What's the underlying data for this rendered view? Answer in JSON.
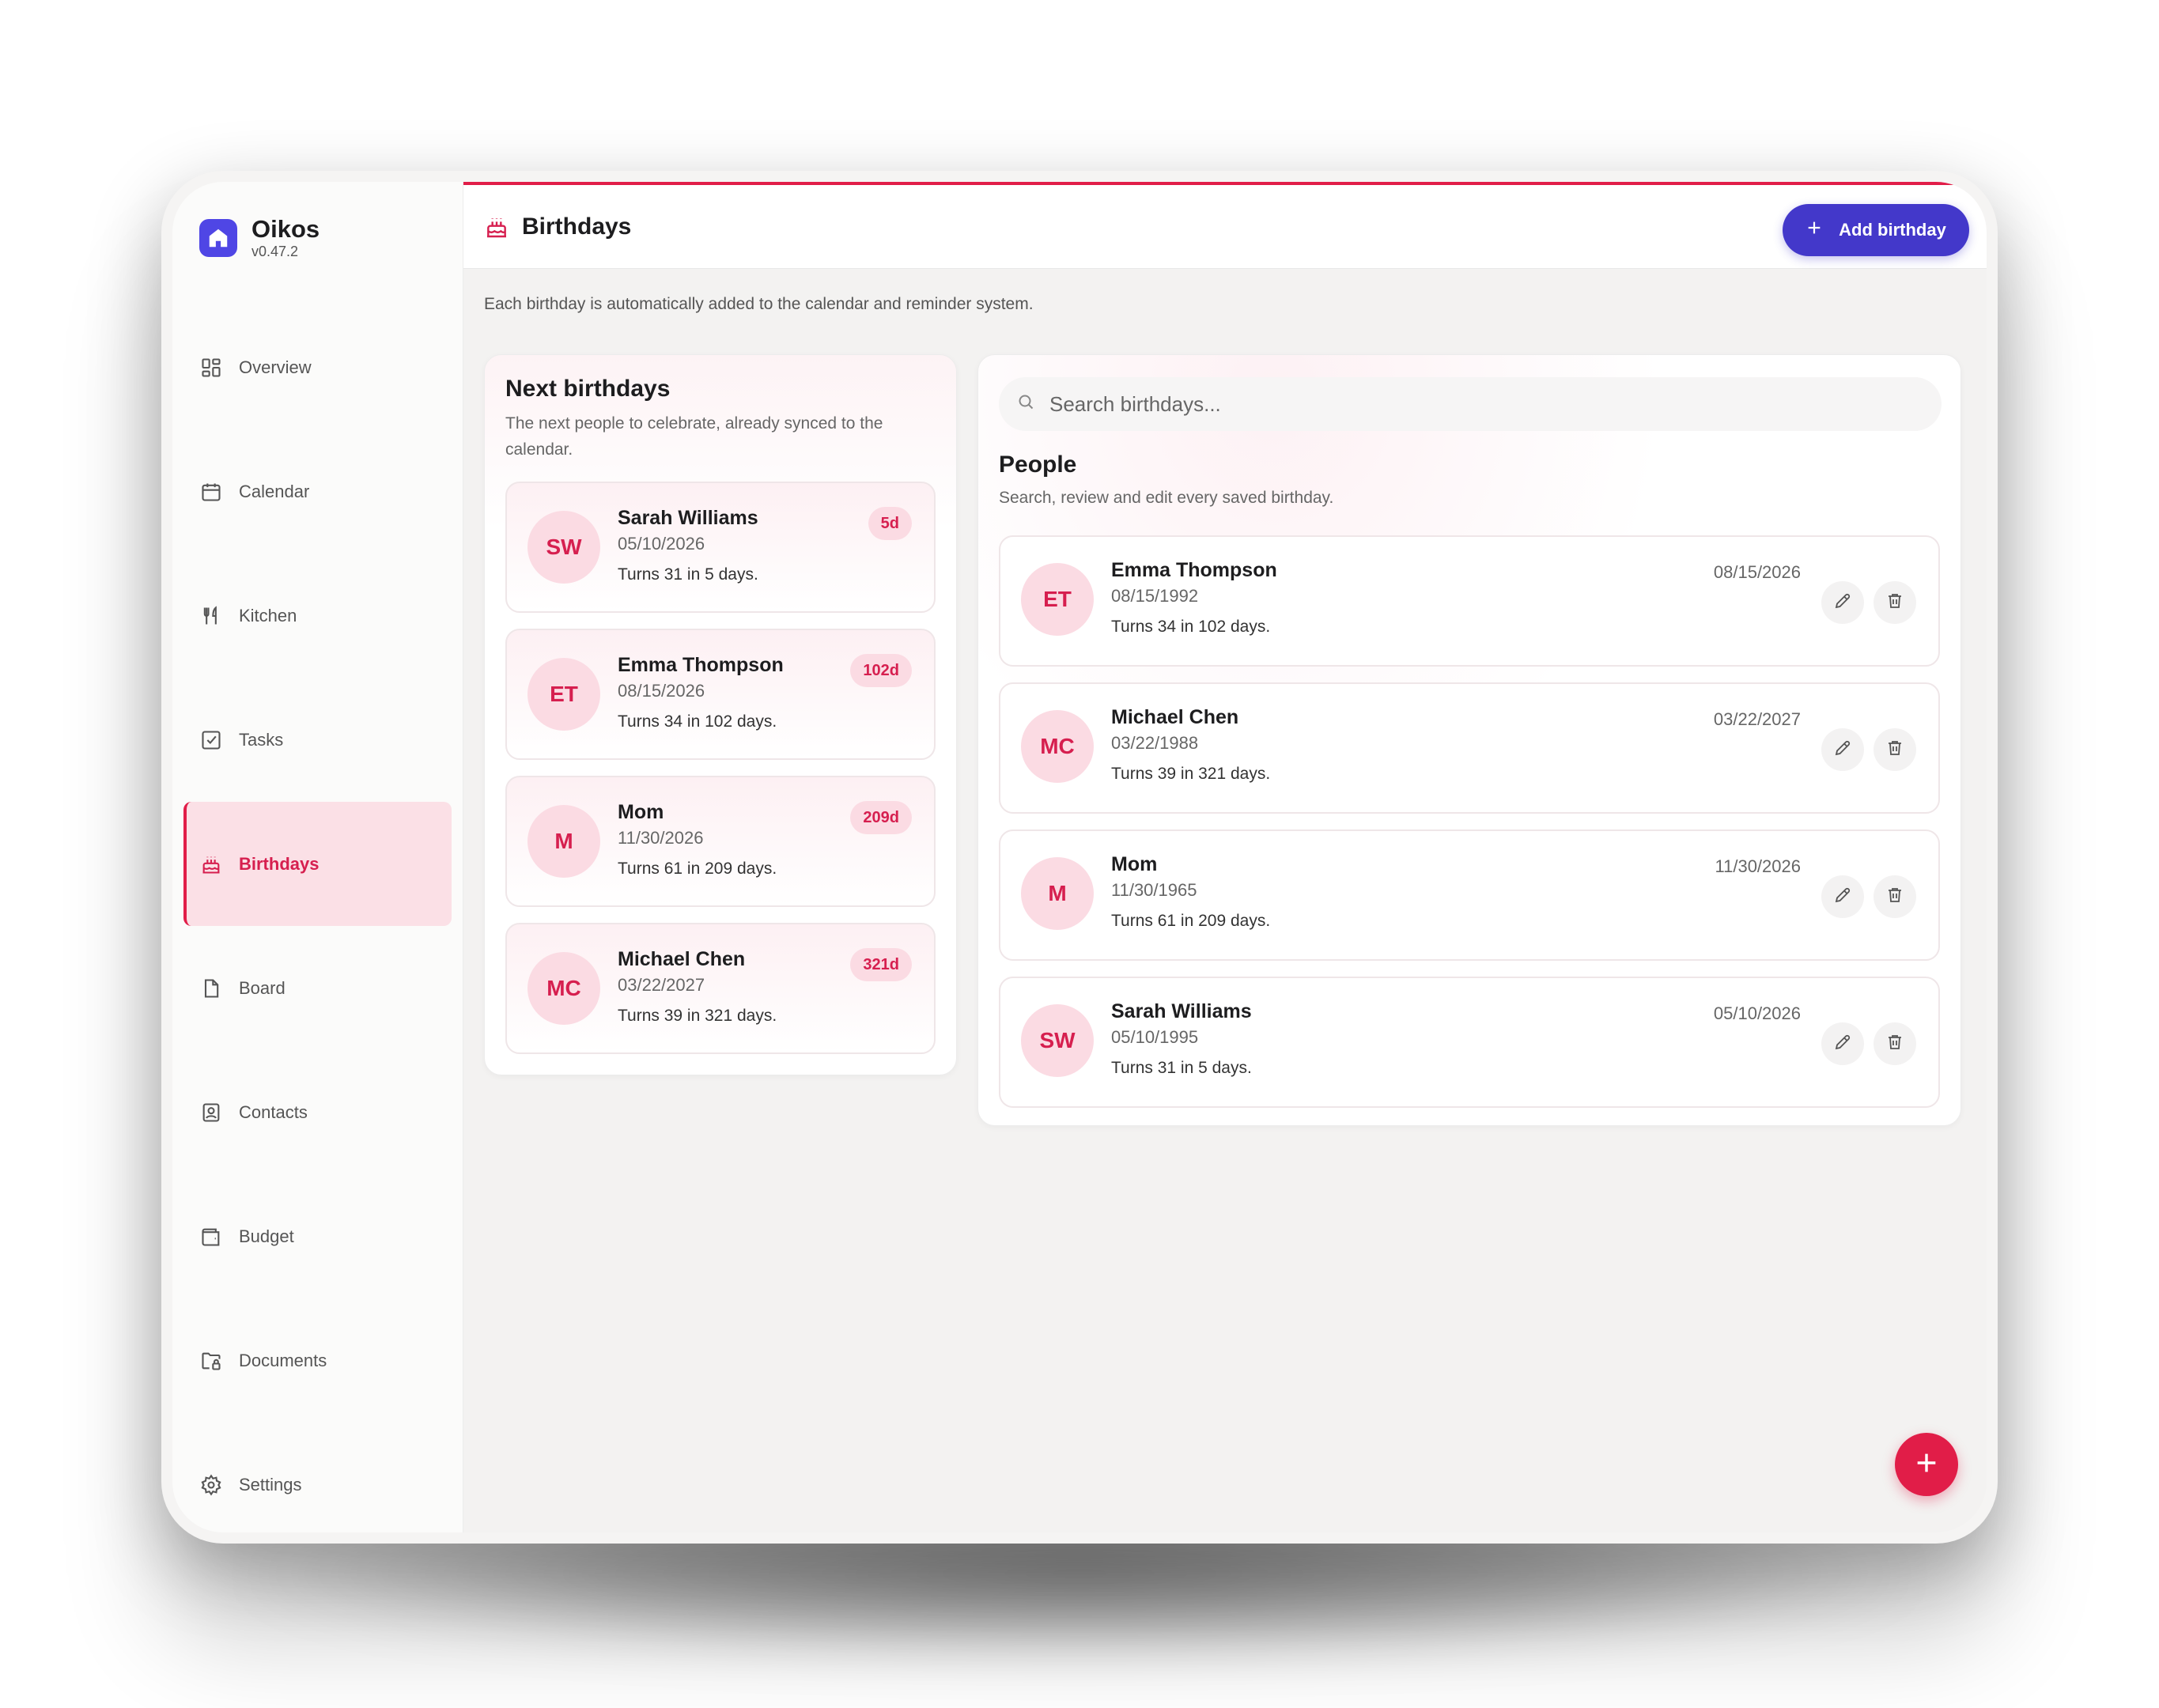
{
  "app": {
    "name": "Oikos",
    "version": "v0.47.2"
  },
  "sidebar": {
    "items": [
      {
        "label": "Overview",
        "icon": "grid-icon"
      },
      {
        "label": "Calendar",
        "icon": "calendar-icon"
      },
      {
        "label": "Kitchen",
        "icon": "utensils-icon"
      },
      {
        "label": "Tasks",
        "icon": "checkbox-icon"
      },
      {
        "label": "Birthdays",
        "icon": "cake-icon",
        "active": true
      },
      {
        "label": "Board",
        "icon": "file-icon"
      },
      {
        "label": "Contacts",
        "icon": "contact-book-icon"
      },
      {
        "label": "Budget",
        "icon": "wallet-icon"
      },
      {
        "label": "Documents",
        "icon": "folder-lock-icon"
      },
      {
        "label": "Settings",
        "icon": "gear-icon"
      }
    ]
  },
  "header": {
    "title": "Birthdays",
    "add_label": "Add birthday",
    "subtitle": "Each birthday is automatically added to the calendar and reminder system."
  },
  "next": {
    "title": "Next birthdays",
    "description": "The next people to celebrate, already synced to the calendar.",
    "items": [
      {
        "initials": "SW",
        "name": "Sarah Williams",
        "date": "05/10/2026",
        "turns": "Turns 31 in 5 days.",
        "badge": "5d"
      },
      {
        "initials": "ET",
        "name": "Emma Thompson",
        "date": "08/15/2026",
        "turns": "Turns 34 in 102 days.",
        "badge": "102d"
      },
      {
        "initials": "M",
        "name": "Mom",
        "date": "11/30/2026",
        "turns": "Turns 61 in 209 days.",
        "badge": "209d"
      },
      {
        "initials": "MC",
        "name": "Michael Chen",
        "date": "03/22/2027",
        "turns": "Turns 39 in 321 days.",
        "badge": "321d"
      }
    ]
  },
  "people": {
    "search_placeholder": "Search birthdays...",
    "title": "People",
    "description": "Search, review and edit every saved birthday.",
    "items": [
      {
        "initials": "ET",
        "name": "Emma Thompson",
        "birth": "08/15/1992",
        "turns": "Turns 34 in 102 days.",
        "next": "08/15/2026"
      },
      {
        "initials": "MC",
        "name": "Michael Chen",
        "birth": "03/22/1988",
        "turns": "Turns 39 in 321 days.",
        "next": "03/22/2027"
      },
      {
        "initials": "M",
        "name": "Mom",
        "birth": "11/30/1965",
        "turns": "Turns 61 in 209 days.",
        "next": "11/30/2026"
      },
      {
        "initials": "SW",
        "name": "Sarah Williams",
        "birth": "05/10/1995",
        "turns": "Turns 31 in 5 days.",
        "next": "05/10/2026"
      }
    ]
  },
  "colors": {
    "accent": "#e11d48",
    "primary": "#4338ca",
    "active_bg": "#fbe0e6"
  }
}
